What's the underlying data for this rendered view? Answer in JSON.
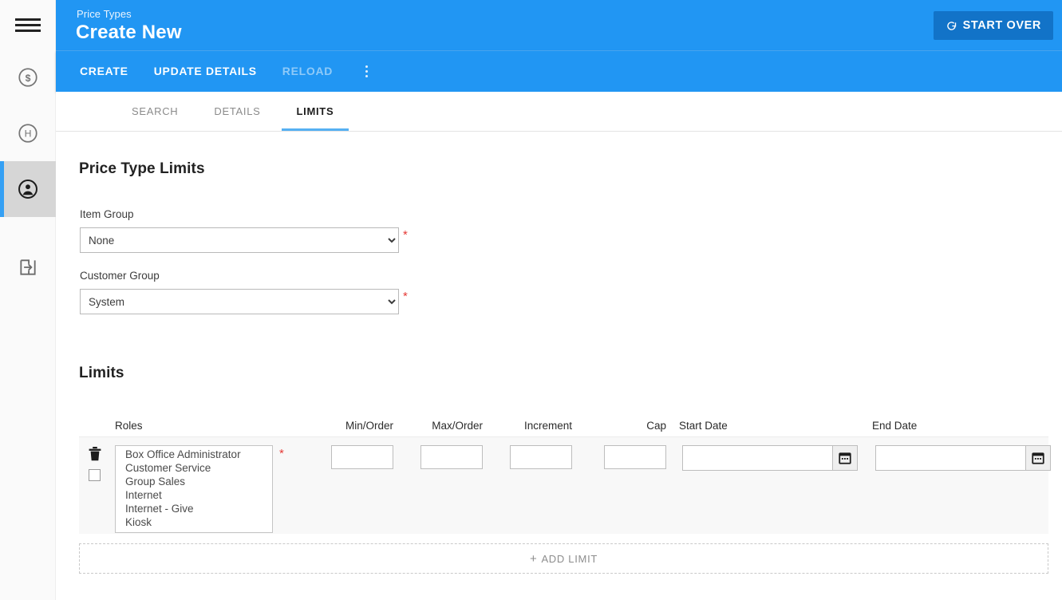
{
  "sidebar": {
    "items": [
      {
        "name": "menu-toggle",
        "icon": "hamburger-icon",
        "active": false
      },
      {
        "name": "finance",
        "icon": "dollar-circle-icon",
        "active": false
      },
      {
        "name": "hold",
        "icon": "h-circle-icon",
        "active": false
      },
      {
        "name": "account",
        "icon": "person-circle-icon",
        "active": true
      },
      {
        "name": "logout",
        "icon": "logout-icon",
        "active": false
      }
    ]
  },
  "header": {
    "breadcrumb": "Price Types",
    "title": "Create New",
    "start_over_label": "START OVER",
    "start_over_icon": "refresh-icon",
    "accent_color": "#2196f3",
    "button_color": "#1273c8"
  },
  "actionbar": {
    "actions": [
      {
        "label": "CREATE",
        "disabled": false
      },
      {
        "label": "UPDATE DETAILS",
        "disabled": false
      },
      {
        "label": "RELOAD",
        "disabled": true
      }
    ],
    "overflow_icon": "kebab-menu-icon"
  },
  "tabs": [
    {
      "label": "SEARCH",
      "active": false
    },
    {
      "label": "DETAILS",
      "active": false
    },
    {
      "label": "LIMITS",
      "active": true
    }
  ],
  "main": {
    "section_title": "Price Type Limits",
    "item_group": {
      "label": "Item Group",
      "value": "None",
      "options": [
        "None"
      ],
      "required": true,
      "required_marker": "*"
    },
    "customer_group": {
      "label": "Customer Group",
      "value": "System",
      "options": [
        "System"
      ],
      "required": true,
      "required_marker": "*"
    },
    "limits_title": "Limits",
    "limits_table": {
      "columns": [
        "Roles",
        "Min/Order",
        "Max/Order",
        "Increment",
        "Cap",
        "Start Date",
        "End Date"
      ],
      "rows": [
        {
          "delete_icon": "trash-icon",
          "roles_options": [
            "Box Office Administrator",
            "Customer Service",
            "Group Sales",
            "Internet",
            "Internet - Give",
            "Kiosk"
          ],
          "roles_required_marker": "*",
          "min_order": "",
          "max_order": "",
          "increment": "",
          "cap": "",
          "start_date": "",
          "end_date": "",
          "calendar_icon": "calendar-icon"
        }
      ]
    },
    "add_limit": {
      "plus": "+",
      "label": "ADD LIMIT"
    }
  }
}
